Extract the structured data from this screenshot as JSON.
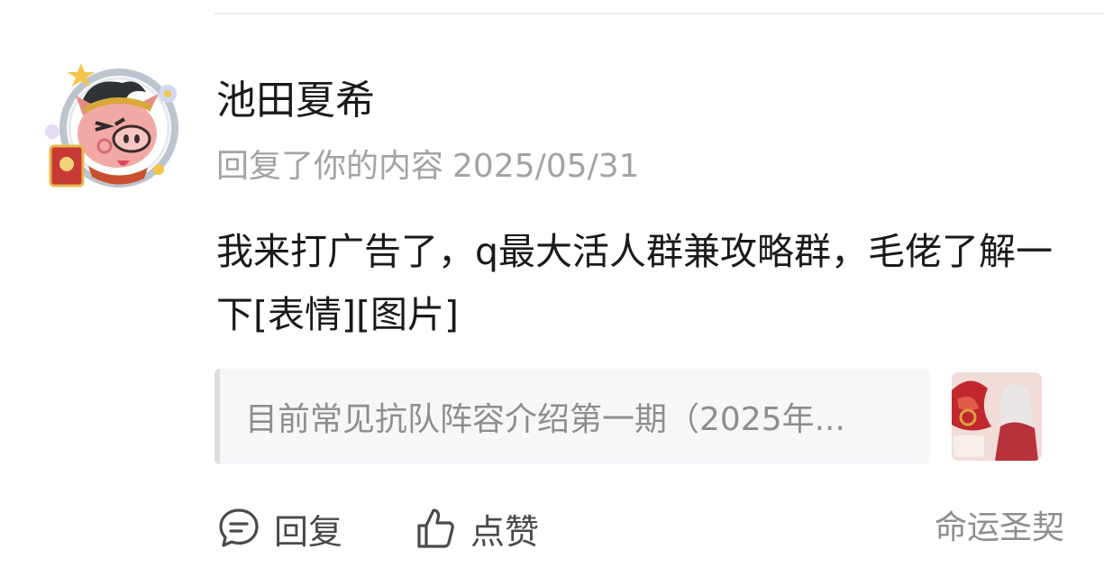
{
  "comment": {
    "author": "池田夏希",
    "action": "回复了你的内容",
    "date": "2025/05/31",
    "text": "我来打广告了，q最大活人群兼攻略群，毛佬了解一下[表情][图片]"
  },
  "quote": {
    "title": "目前常见抗队阵容介绍第一期（2025年..."
  },
  "actions": {
    "reply_label": "回复",
    "like_label": "点赞"
  },
  "game_tag": "命运圣契",
  "icons": {
    "reply": "chat-bubble-icon",
    "like": "thumbs-up-icon"
  },
  "colors": {
    "text_primary": "#1a1a1a",
    "text_secondary": "#a3a3a3",
    "quote_bg": "#f6f7f9"
  }
}
